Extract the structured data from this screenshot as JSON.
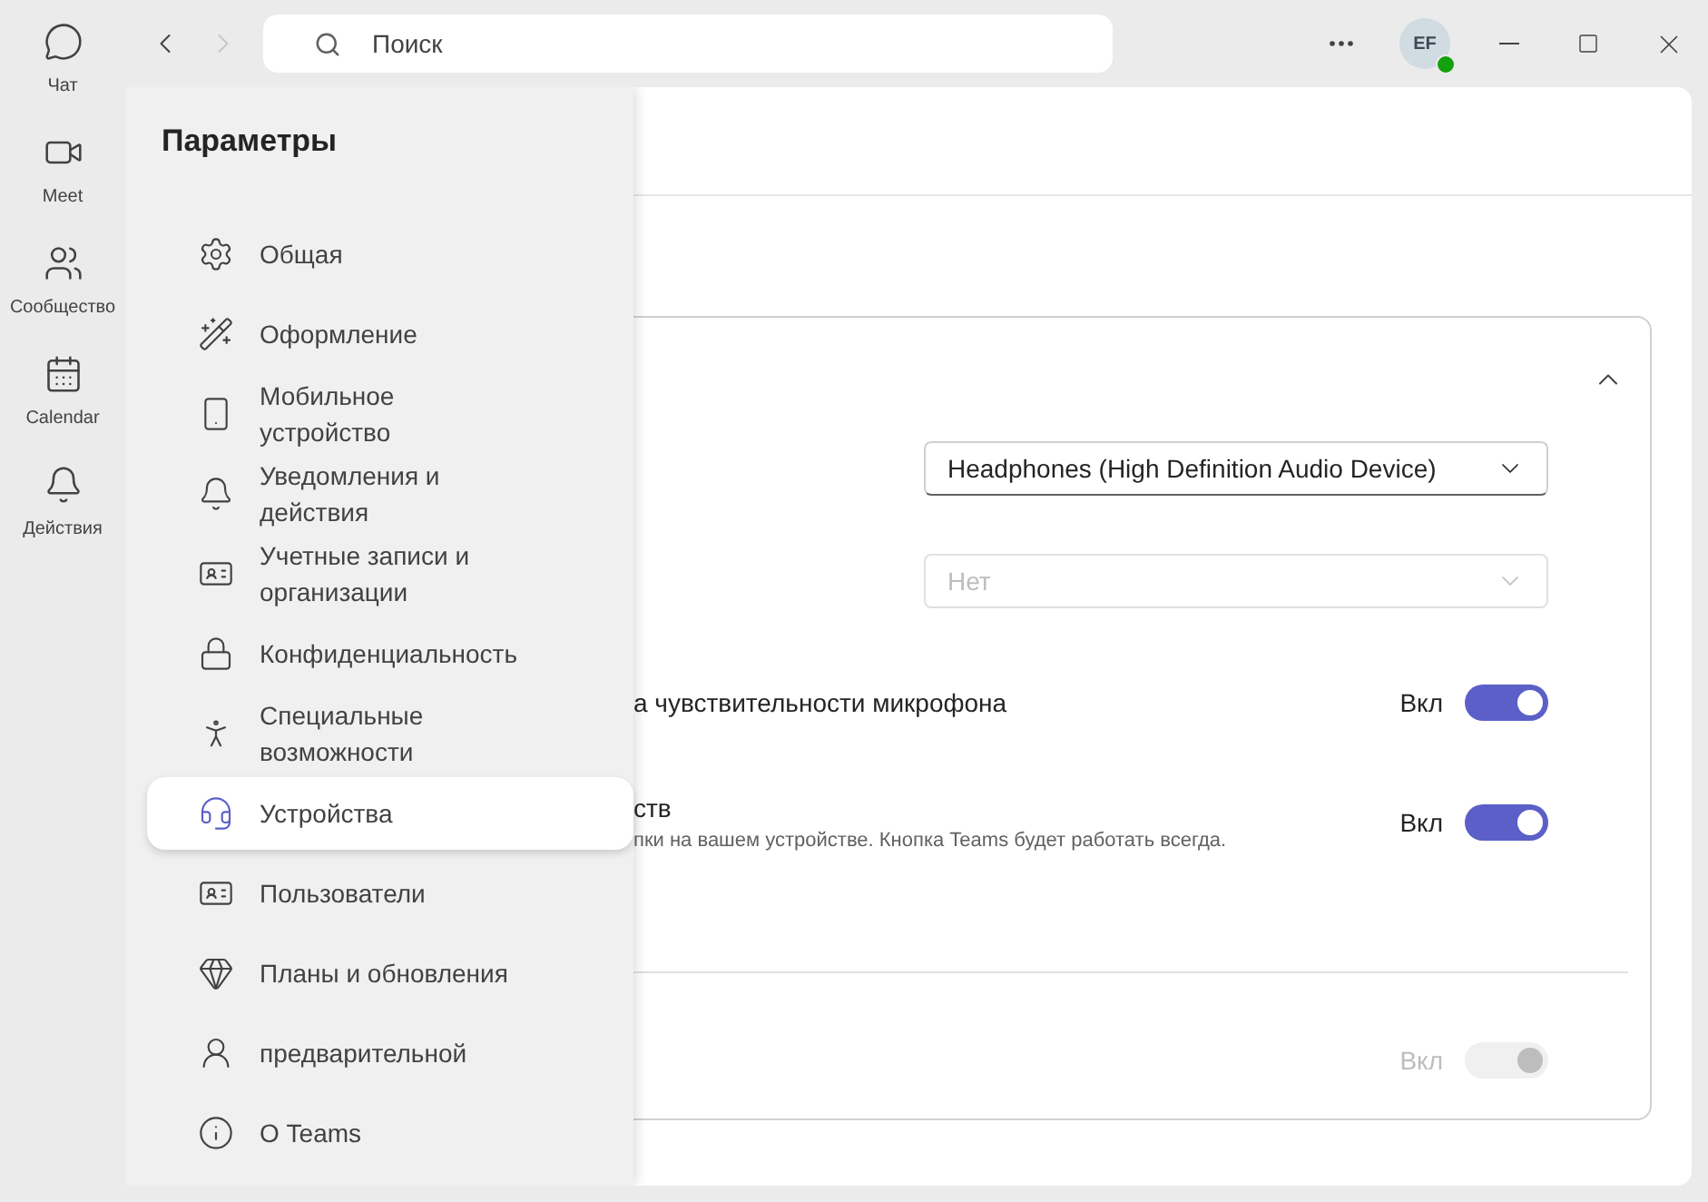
{
  "rail": [
    {
      "label": "Чат"
    },
    {
      "label": "Meet"
    },
    {
      "label": "Сообщество"
    },
    {
      "label": "Calendar"
    },
    {
      "label": "Действия"
    }
  ],
  "topbar": {
    "back": {
      "disabled": false
    },
    "forward": {
      "disabled": true
    },
    "search": {
      "placeholder": "Поиск"
    },
    "avatar": "EF"
  },
  "settings": {
    "title": "Параметры",
    "items": [
      {
        "label": "Общая",
        "selected": false
      },
      {
        "label": "Оформление",
        "selected": false
      },
      {
        "label": "Мобильное устройство",
        "selected": false
      },
      {
        "label": "Уведомления и действия",
        "selected": false
      },
      {
        "label": "Учетные записи и организации",
        "selected": false
      },
      {
        "label": "Конфиденциальность",
        "selected": false
      },
      {
        "label": "Специальные возможности",
        "selected": false
      },
      {
        "label": "Устройства",
        "selected": true
      },
      {
        "label": "Пользователи",
        "selected": false
      },
      {
        "label": "Планы и обновления",
        "selected": false
      },
      {
        "label": "предварительной",
        "selected": false
      },
      {
        "label": "О Teams",
        "selected": false
      }
    ]
  },
  "card": {
    "expanded": true,
    "dropdowns": [
      {
        "value": "Headphones (High Definition Audio Device)",
        "disabled": false
      },
      {
        "value": "Нет",
        "disabled": true
      }
    ],
    "toggles": [
      {
        "title": "а чувствительности микрофона",
        "state": "Вкл",
        "on": true,
        "disabled": false
      },
      {
        "title": "ств",
        "description": "пки на вашем устройстве. Кнопка Teams будет работать всегда.",
        "state": "Вкл",
        "on": true,
        "disabled": false
      }
    ],
    "footer_toggle": {
      "state": "Вкл",
      "on": true,
      "disabled": true
    }
  }
}
